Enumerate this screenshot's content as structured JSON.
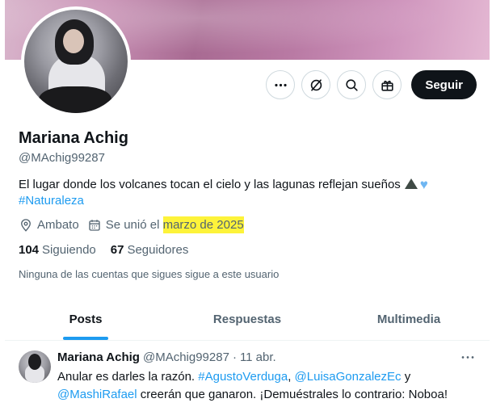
{
  "profile": {
    "name": "Mariana Achig",
    "handle": "@MAchig99287",
    "bio_text": "El lugar donde los volcanes tocan el cielo y las lagunas reflejan sueños",
    "bio_hashtag": "#Naturaleza",
    "location": "Ambato",
    "joined_prefix": "Se unió el",
    "joined_date": "marzo de 2025",
    "following_count": "104",
    "following_label": "Siguiendo",
    "followers_count": "67",
    "followers_label": "Seguidores",
    "mutual_note": "Ninguna de las cuentas que sigues sigue a este usuario"
  },
  "actions": {
    "more_icon": "more-horizontal-icon",
    "grok_icon": "grok-icon",
    "search_icon": "search-icon",
    "subscribe_icon": "gift-icon",
    "follow_label": "Seguir"
  },
  "tabs": [
    {
      "label": "Posts",
      "active": true
    },
    {
      "label": "Respuestas",
      "active": false
    },
    {
      "label": "Multimedia",
      "active": false
    }
  ],
  "tweet": {
    "name": "Mariana Achig",
    "handle": "@MAchig99287",
    "separator": "·",
    "date": "11 abr.",
    "text_1": "Anular es darles la razón.",
    "mention_1": "#AgustoVerduga",
    "sep_1": ",",
    "mention_2": "@LuisaGonzalezEc",
    "sep_2": "y",
    "mention_3": "@MashiRafael",
    "text_2": "creerán que ganaron. ¡Demuéstrales lo contrario: Noboa!"
  },
  "colors": {
    "accent": "#1d9bf0",
    "highlight": "#fdf33a",
    "text_primary": "#0f1419",
    "text_secondary": "#536471"
  }
}
